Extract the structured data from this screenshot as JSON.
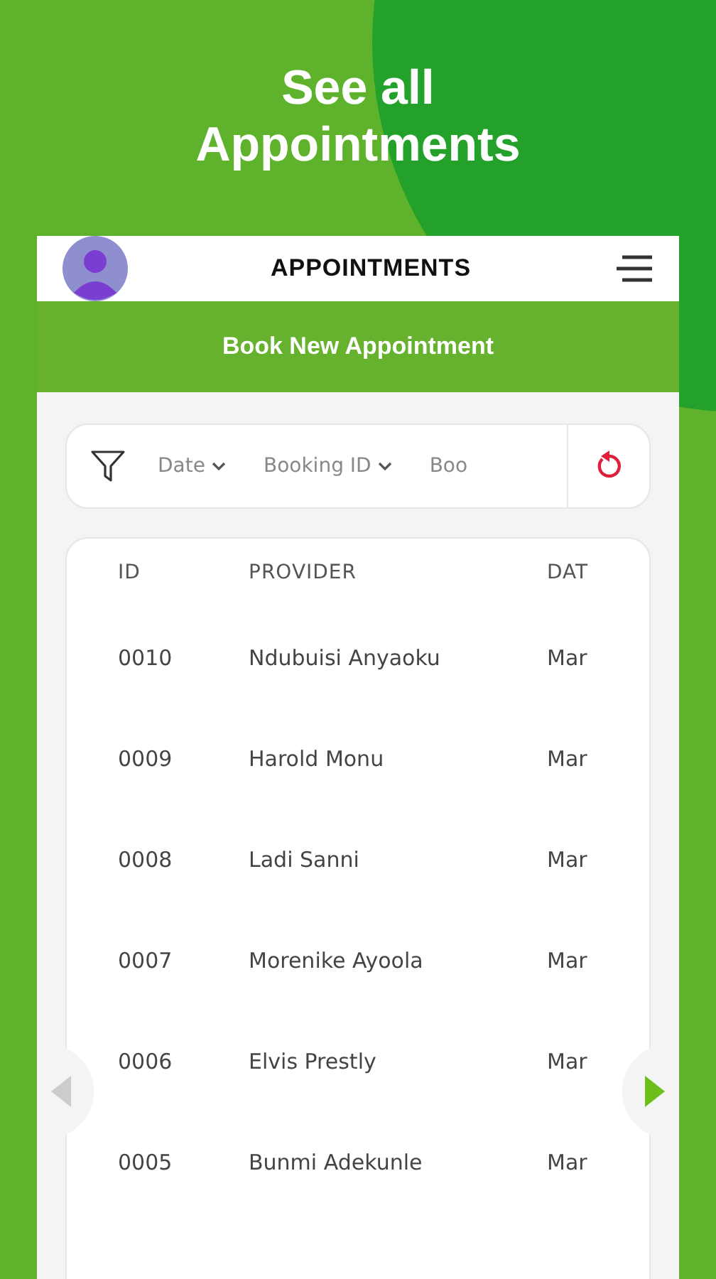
{
  "headline": [
    "See all",
    "Appointments"
  ],
  "header": {
    "title": "APPOINTMENTS"
  },
  "book_button": "Book New Appointment",
  "filters": [
    {
      "label": "Date",
      "dropdown": true
    },
    {
      "label": "Booking ID",
      "dropdown": true
    },
    {
      "label": "Boo",
      "dropdown": false
    }
  ],
  "table": {
    "columns": [
      "ID",
      "PROVIDER",
      "DAT"
    ],
    "rows": [
      [
        "0010",
        "Ndubuisi Anyaoku",
        "Mar"
      ],
      [
        "0009",
        "Harold Monu",
        "Mar"
      ],
      [
        "0008",
        "Ladi Sanni",
        "Mar"
      ],
      [
        "0007",
        "Morenike Ayoola",
        "Mar"
      ],
      [
        "0006",
        "Elvis Prestly",
        "Mar"
      ],
      [
        "0005",
        "Bunmi Adekunle",
        "Mar"
      ]
    ]
  },
  "pager": {
    "prev_disabled": true,
    "next_disabled": false
  }
}
